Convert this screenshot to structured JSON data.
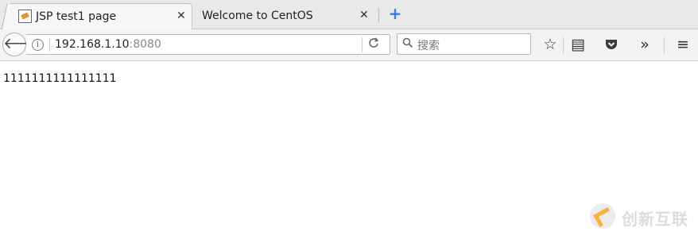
{
  "tabs": [
    {
      "title": "JSP test1 page",
      "close_label": "✕",
      "favicon": "image-icon"
    },
    {
      "title": "Welcome to CentOS",
      "close_label": "✕"
    }
  ],
  "new_tab_label": "+",
  "navbar": {
    "back_label": "🡐",
    "info_label": "i",
    "url_host": "192.168.1.10",
    "url_port": ":8080",
    "reload_label": "C",
    "search_icon": "search-icon",
    "search_placeholder": "搜索",
    "toolbar": [
      {
        "name": "bookmark-star-icon",
        "glyph": "☆"
      },
      {
        "name": "reader-view-icon",
        "glyph": "▤"
      },
      {
        "name": "pocket-icon",
        "glyph": "⛉"
      },
      {
        "name": "overflow-chevron-icon",
        "glyph": "»"
      },
      {
        "name": "menu-hamburger-icon",
        "glyph": "≡"
      }
    ]
  },
  "page": {
    "body_text": "1111111111111111"
  },
  "watermark": {
    "text": "创新互联"
  }
}
